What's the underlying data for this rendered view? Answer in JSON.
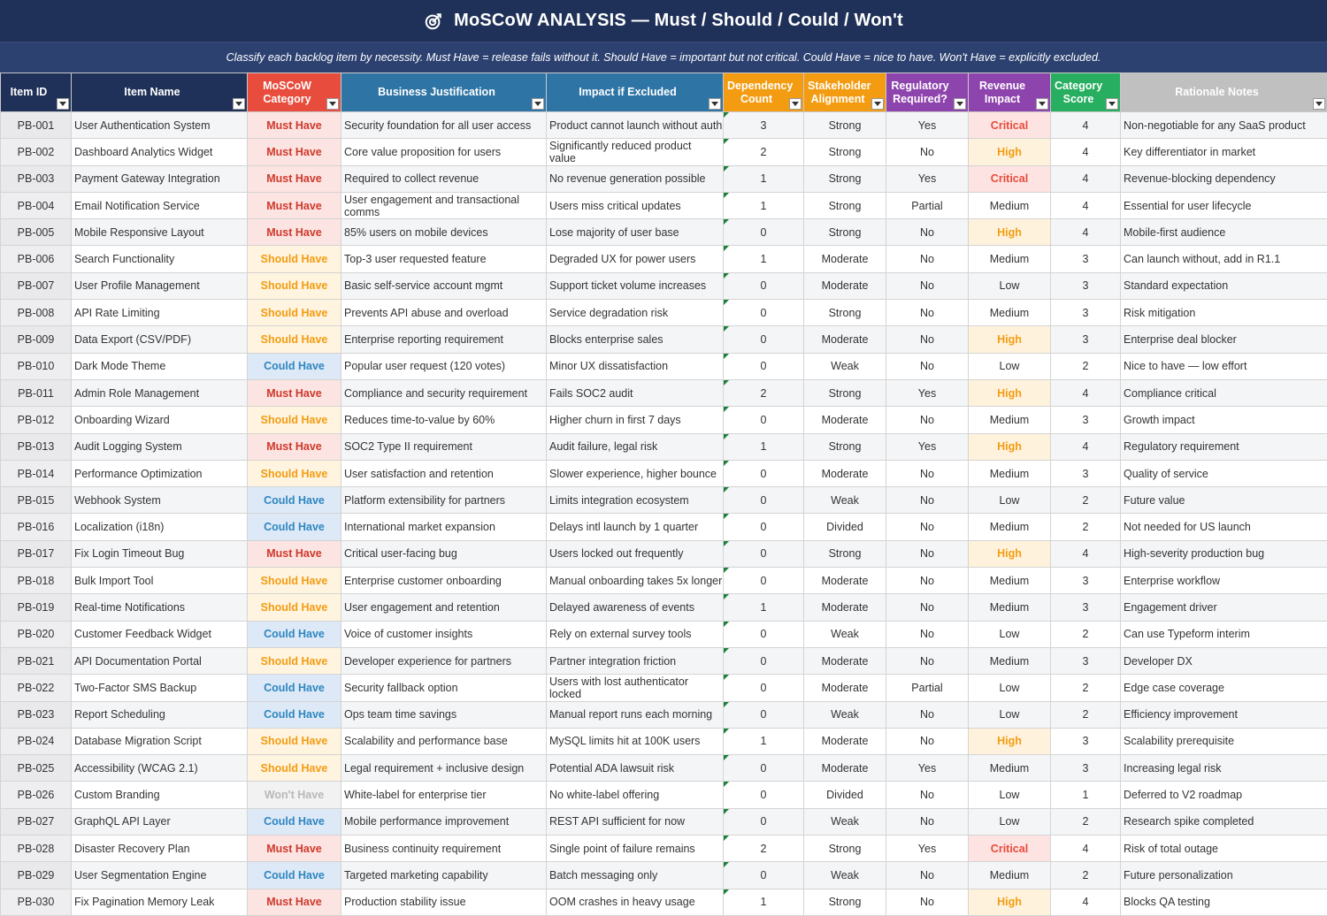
{
  "title": "MoSCoW ANALYSIS — Must / Should / Could / Won't",
  "subtitle": "Classify each backlog item by necessity. Must Have = release fails without it. Should Have = important but not critical. Could Have = nice to have. Won't Have = explicitly excluded.",
  "colors": {
    "title_bg": "#1f3158",
    "subtitle_bg": "#2c4170",
    "must": "#d0392b",
    "should": "#f39c12",
    "could": "#2e86c1",
    "wont": "#b8b8b8",
    "critical": "#e74c3c",
    "high": "#f39c12"
  },
  "columns": [
    {
      "key": "id",
      "label": "Item ID",
      "bg": "#1f3158"
    },
    {
      "key": "name",
      "label": "Item Name",
      "bg": "#1f3158"
    },
    {
      "key": "category",
      "label": "MoSCoW Category",
      "bg": "#e74c3c"
    },
    {
      "key": "justification",
      "label": "Business Justification",
      "bg": "#2e75a6"
    },
    {
      "key": "impact",
      "label": "Impact if Excluded",
      "bg": "#2e75a6"
    },
    {
      "key": "dependency",
      "label": "Dependency Count",
      "bg": "#f39c12"
    },
    {
      "key": "stakeholder",
      "label": "Stakeholder Alignment",
      "bg": "#f39c12"
    },
    {
      "key": "regulatory",
      "label": "Regulatory Required?",
      "bg": "#8e44ad"
    },
    {
      "key": "revenue",
      "label": "Revenue Impact",
      "bg": "#8e44ad"
    },
    {
      "key": "score",
      "label": "Category Score",
      "bg": "#27ae60"
    },
    {
      "key": "notes",
      "label": "Rationale Notes",
      "bg": "#c0c0c0"
    }
  ],
  "rows": [
    {
      "id": "PB-001",
      "name": "User Authentication System",
      "category": "Must Have",
      "justification": "Security foundation for all user access",
      "impact": "Product cannot launch without auth",
      "dependency": "3",
      "stakeholder": "Strong",
      "regulatory": "Yes",
      "revenue": "Critical",
      "score": "4",
      "notes": "Non-negotiable for any SaaS product"
    },
    {
      "id": "PB-002",
      "name": "Dashboard Analytics Widget",
      "category": "Must Have",
      "justification": "Core value proposition for users",
      "impact": "Significantly reduced product value",
      "dependency": "2",
      "stakeholder": "Strong",
      "regulatory": "No",
      "revenue": "High",
      "score": "4",
      "notes": "Key differentiator in market"
    },
    {
      "id": "PB-003",
      "name": "Payment Gateway Integration",
      "category": "Must Have",
      "justification": "Required to collect revenue",
      "impact": "No revenue generation possible",
      "dependency": "1",
      "stakeholder": "Strong",
      "regulatory": "Yes",
      "revenue": "Critical",
      "score": "4",
      "notes": "Revenue-blocking dependency"
    },
    {
      "id": "PB-004",
      "name": "Email Notification Service",
      "category": "Must Have",
      "justification": "User engagement and transactional comms",
      "impact": "Users miss critical updates",
      "dependency": "1",
      "stakeholder": "Strong",
      "regulatory": "Partial",
      "revenue": "Medium",
      "score": "4",
      "notes": "Essential for user lifecycle"
    },
    {
      "id": "PB-005",
      "name": "Mobile Responsive Layout",
      "category": "Must Have",
      "justification": "85% users on mobile devices",
      "impact": "Lose majority of user base",
      "dependency": "0",
      "stakeholder": "Strong",
      "regulatory": "No",
      "revenue": "High",
      "score": "4",
      "notes": "Mobile-first audience"
    },
    {
      "id": "PB-006",
      "name": "Search Functionality",
      "category": "Should Have",
      "justification": "Top-3 user requested feature",
      "impact": "Degraded UX for power users",
      "dependency": "1",
      "stakeholder": "Moderate",
      "regulatory": "No",
      "revenue": "Medium",
      "score": "3",
      "notes": "Can launch without, add in R1.1"
    },
    {
      "id": "PB-007",
      "name": "User Profile Management",
      "category": "Should Have",
      "justification": "Basic self-service account mgmt",
      "impact": "Support ticket volume increases",
      "dependency": "0",
      "stakeholder": "Moderate",
      "regulatory": "No",
      "revenue": "Low",
      "score": "3",
      "notes": "Standard expectation"
    },
    {
      "id": "PB-008",
      "name": "API Rate Limiting",
      "category": "Should Have",
      "justification": "Prevents API abuse and overload",
      "impact": "Service degradation risk",
      "dependency": "0",
      "stakeholder": "Strong",
      "regulatory": "No",
      "revenue": "Medium",
      "score": "3",
      "notes": "Risk mitigation"
    },
    {
      "id": "PB-009",
      "name": "Data Export (CSV/PDF)",
      "category": "Should Have",
      "justification": "Enterprise reporting requirement",
      "impact": "Blocks enterprise sales",
      "dependency": "0",
      "stakeholder": "Moderate",
      "regulatory": "No",
      "revenue": "High",
      "score": "3",
      "notes": "Enterprise deal blocker"
    },
    {
      "id": "PB-010",
      "name": "Dark Mode Theme",
      "category": "Could Have",
      "justification": "Popular user request (120 votes)",
      "impact": "Minor UX dissatisfaction",
      "dependency": "0",
      "stakeholder": "Weak",
      "regulatory": "No",
      "revenue": "Low",
      "score": "2",
      "notes": "Nice to have — low effort"
    },
    {
      "id": "PB-011",
      "name": "Admin Role Management",
      "category": "Must Have",
      "justification": "Compliance and security requirement",
      "impact": "Fails SOC2 audit",
      "dependency": "2",
      "stakeholder": "Strong",
      "regulatory": "Yes",
      "revenue": "High",
      "score": "4",
      "notes": "Compliance critical"
    },
    {
      "id": "PB-012",
      "name": "Onboarding Wizard",
      "category": "Should Have",
      "justification": "Reduces time-to-value by 60%",
      "impact": "Higher churn in first 7 days",
      "dependency": "0",
      "stakeholder": "Moderate",
      "regulatory": "No",
      "revenue": "Medium",
      "score": "3",
      "notes": "Growth impact"
    },
    {
      "id": "PB-013",
      "name": "Audit Logging System",
      "category": "Must Have",
      "justification": "SOC2 Type II requirement",
      "impact": "Audit failure, legal risk",
      "dependency": "1",
      "stakeholder": "Strong",
      "regulatory": "Yes",
      "revenue": "High",
      "score": "4",
      "notes": "Regulatory requirement"
    },
    {
      "id": "PB-014",
      "name": "Performance Optimization",
      "category": "Should Have",
      "justification": "User satisfaction and retention",
      "impact": "Slower experience, higher bounce",
      "dependency": "0",
      "stakeholder": "Moderate",
      "regulatory": "No",
      "revenue": "Medium",
      "score": "3",
      "notes": "Quality of service"
    },
    {
      "id": "PB-015",
      "name": "Webhook System",
      "category": "Could Have",
      "justification": "Platform extensibility for partners",
      "impact": "Limits integration ecosystem",
      "dependency": "0",
      "stakeholder": "Weak",
      "regulatory": "No",
      "revenue": "Low",
      "score": "2",
      "notes": "Future value"
    },
    {
      "id": "PB-016",
      "name": "Localization (i18n)",
      "category": "Could Have",
      "justification": "International market expansion",
      "impact": "Delays intl launch by 1 quarter",
      "dependency": "0",
      "stakeholder": "Divided",
      "regulatory": "No",
      "revenue": "Medium",
      "score": "2",
      "notes": "Not needed for US launch"
    },
    {
      "id": "PB-017",
      "name": "Fix Login Timeout Bug",
      "category": "Must Have",
      "justification": "Critical user-facing bug",
      "impact": "Users locked out frequently",
      "dependency": "0",
      "stakeholder": "Strong",
      "regulatory": "No",
      "revenue": "High",
      "score": "4",
      "notes": "High-severity production bug"
    },
    {
      "id": "PB-018",
      "name": "Bulk Import Tool",
      "category": "Should Have",
      "justification": "Enterprise customer onboarding",
      "impact": "Manual onboarding takes 5x longer",
      "dependency": "0",
      "stakeholder": "Moderate",
      "regulatory": "No",
      "revenue": "Medium",
      "score": "3",
      "notes": "Enterprise workflow"
    },
    {
      "id": "PB-019",
      "name": "Real-time Notifications",
      "category": "Should Have",
      "justification": "User engagement and retention",
      "impact": "Delayed awareness of events",
      "dependency": "1",
      "stakeholder": "Moderate",
      "regulatory": "No",
      "revenue": "Medium",
      "score": "3",
      "notes": "Engagement driver"
    },
    {
      "id": "PB-020",
      "name": "Customer Feedback Widget",
      "category": "Could Have",
      "justification": "Voice of customer insights",
      "impact": "Rely on external survey tools",
      "dependency": "0",
      "stakeholder": "Weak",
      "regulatory": "No",
      "revenue": "Low",
      "score": "2",
      "notes": "Can use Typeform interim"
    },
    {
      "id": "PB-021",
      "name": "API Documentation Portal",
      "category": "Should Have",
      "justification": "Developer experience for partners",
      "impact": "Partner integration friction",
      "dependency": "0",
      "stakeholder": "Moderate",
      "regulatory": "No",
      "revenue": "Medium",
      "score": "3",
      "notes": "Developer DX"
    },
    {
      "id": "PB-022",
      "name": "Two-Factor SMS Backup",
      "category": "Could Have",
      "justification": "Security fallback option",
      "impact": "Users with lost authenticator locked",
      "dependency": "0",
      "stakeholder": "Moderate",
      "regulatory": "Partial",
      "revenue": "Low",
      "score": "2",
      "notes": "Edge case coverage"
    },
    {
      "id": "PB-023",
      "name": "Report Scheduling",
      "category": "Could Have",
      "justification": "Ops team time savings",
      "impact": "Manual report runs each morning",
      "dependency": "0",
      "stakeholder": "Weak",
      "regulatory": "No",
      "revenue": "Low",
      "score": "2",
      "notes": "Efficiency improvement"
    },
    {
      "id": "PB-024",
      "name": "Database Migration Script",
      "category": "Should Have",
      "justification": "Scalability and performance base",
      "impact": "MySQL limits hit at 100K users",
      "dependency": "1",
      "stakeholder": "Moderate",
      "regulatory": "No",
      "revenue": "High",
      "score": "3",
      "notes": "Scalability prerequisite"
    },
    {
      "id": "PB-025",
      "name": "Accessibility (WCAG 2.1)",
      "category": "Should Have",
      "justification": "Legal requirement + inclusive design",
      "impact": "Potential ADA lawsuit risk",
      "dependency": "0",
      "stakeholder": "Moderate",
      "regulatory": "Yes",
      "revenue": "Medium",
      "score": "3",
      "notes": "Increasing legal risk"
    },
    {
      "id": "PB-026",
      "name": "Custom Branding",
      "category": "Won't Have",
      "justification": "White-label for enterprise tier",
      "impact": "No white-label offering",
      "dependency": "0",
      "stakeholder": "Divided",
      "regulatory": "No",
      "revenue": "Low",
      "score": "1",
      "notes": "Deferred to V2 roadmap"
    },
    {
      "id": "PB-027",
      "name": "GraphQL API Layer",
      "category": "Could Have",
      "justification": "Mobile performance improvement",
      "impact": "REST API sufficient for now",
      "dependency": "0",
      "stakeholder": "Weak",
      "regulatory": "No",
      "revenue": "Low",
      "score": "2",
      "notes": "Research spike completed"
    },
    {
      "id": "PB-028",
      "name": "Disaster Recovery Plan",
      "category": "Must Have",
      "justification": "Business continuity requirement",
      "impact": "Single point of failure remains",
      "dependency": "2",
      "stakeholder": "Strong",
      "regulatory": "Yes",
      "revenue": "Critical",
      "score": "4",
      "notes": "Risk of total outage"
    },
    {
      "id": "PB-029",
      "name": "User Segmentation Engine",
      "category": "Could Have",
      "justification": "Targeted marketing capability",
      "impact": "Batch messaging only",
      "dependency": "0",
      "stakeholder": "Weak",
      "regulatory": "No",
      "revenue": "Medium",
      "score": "2",
      "notes": "Future personalization"
    },
    {
      "id": "PB-030",
      "name": "Fix Pagination Memory Leak",
      "category": "Must Have",
      "justification": "Production stability issue",
      "impact": "OOM crashes in heavy usage",
      "dependency": "1",
      "stakeholder": "Strong",
      "regulatory": "No",
      "revenue": "High",
      "score": "4",
      "notes": "Blocks QA testing"
    }
  ]
}
